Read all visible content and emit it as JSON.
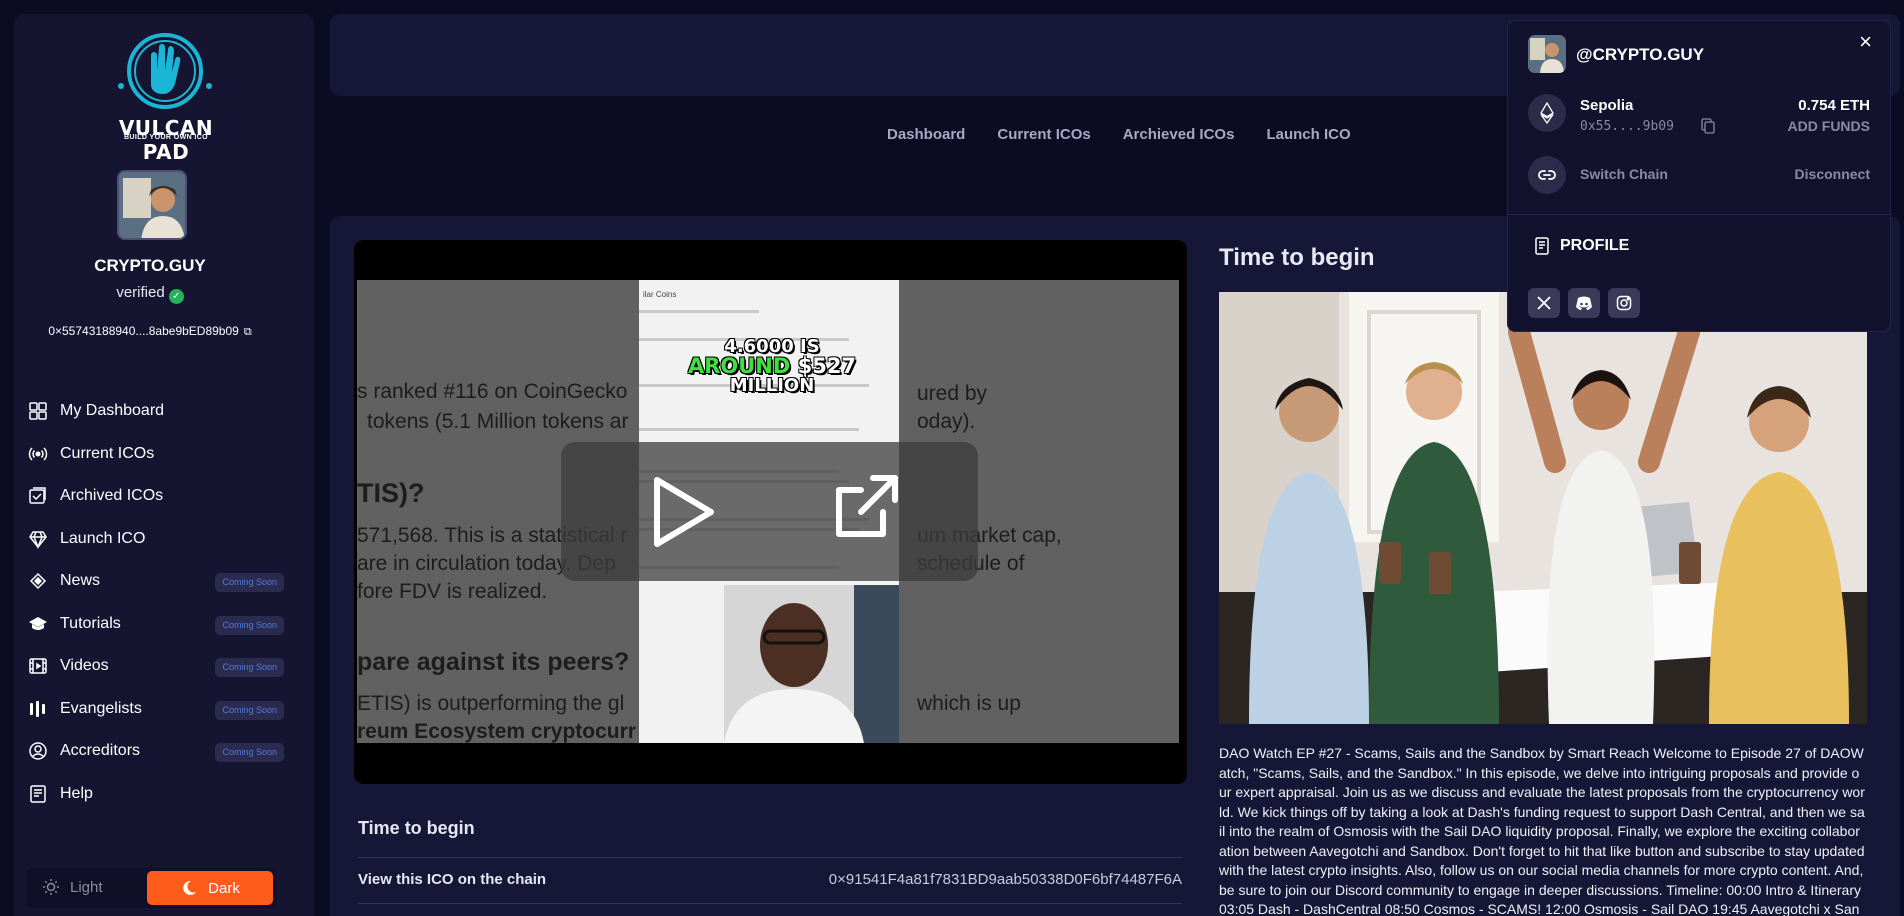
{
  "brand": {
    "name": "VULCAN PAD",
    "tagline": "BUILD YOUR OWN ICO",
    "accent": "#ff5b1a",
    "logo_color": "#1bb5d6"
  },
  "user": {
    "name": "CRYPTO.GUY",
    "verified_label": "verified",
    "address": "0×55743188940....8abe9bED89b09"
  },
  "sidebar": {
    "items": [
      {
        "label": "My Dashboard",
        "icon": "dashboard-icon",
        "badge": ""
      },
      {
        "label": "Current ICOs",
        "icon": "broadcast-icon",
        "badge": ""
      },
      {
        "label": "Archived ICOs",
        "icon": "archive-icon",
        "badge": ""
      },
      {
        "label": "Launch ICO",
        "icon": "diamond-icon",
        "badge": ""
      },
      {
        "label": "News",
        "icon": "news-icon",
        "badge": "Coming Soon"
      },
      {
        "label": "Tutorials",
        "icon": "graduation-cap-icon",
        "badge": "Coming Soon"
      },
      {
        "label": "Videos",
        "icon": "film-icon",
        "badge": "Coming Soon"
      },
      {
        "label": "Evangelists",
        "icon": "bars-icon",
        "badge": "Coming Soon"
      },
      {
        "label": "Accreditors",
        "icon": "user-circle-icon",
        "badge": "Coming Soon"
      },
      {
        "label": "Help",
        "icon": "help-doc-icon",
        "badge": ""
      }
    ]
  },
  "theme": {
    "light": "Light",
    "dark": "Dark"
  },
  "topnav": [
    "Dashboard",
    "Current ICOs",
    "Archieved ICOs",
    "Launch ICO"
  ],
  "video": {
    "bg_heading_1": "s ranked #116 on CoinGecko",
    "bg_heading_2": "tokens (5.1 Million tokens ar",
    "bg_heading_3": "TIS)?",
    "bg_heading_4": "571,568. This is a statistical r",
    "bg_heading_5": "are in circulation today. Dep",
    "bg_heading_6": "fore FDV is realized.",
    "bg_heading_7": "pare against its peers?",
    "bg_heading_8": "ETIS) is outperforming the gl",
    "bg_heading_9": "reum Ecosystem cryptocurr",
    "bg_right_1": "ured by",
    "bg_right_2": "oday).",
    "bg_right_3": "um market cap,",
    "bg_right_4": "schedule of",
    "bg_right_5": "which is up",
    "thumb_header": "ilar Coins",
    "thumb_line1": "4.6000 IS",
    "thumb_line2a": "AROUND",
    "thumb_line2b": "$527",
    "thumb_line3": "MILLION"
  },
  "ico": {
    "title": "Time to begin",
    "chain_label": "View this ICO on the chain",
    "chain_address": "0×91541F4a81f7831BD9aab50338D0F6bf74487F6A"
  },
  "right": {
    "title": "Time to begin",
    "description": "DAO Watch EP #27 - Scams, Sails and the Sandbox by Smart Reach Welcome to Episode 27 of DAOWatch, \"Scams, Sails, and the Sandbox.\" In this episode, we delve into intriguing proposals and provide our expert appraisal. Join us as we discuss and evaluate the latest proposals from the cryptocurrency world. We kick things off by taking a look at Dash's funding request to support Dash Central, and then we sail into the realm of Osmosis with the Sail DAO liquidity proposal. Finally, we explore the exciting collaboration between Aavegotchi and Sandbox. Don't forget to hit that like button and subscribe to stay updated with the latest crypto insights. Also, follow us on our social media channels for more crypto content. And, be sure to join our Discord community to engage in deeper discussions. Timeline: 00:00 Intro & Itinerary 03:05 Dash - DashCentral 08:50 Cosmos - SCAMS! 12:00 Osmosis - Sail DAO 19:45 Aavegotchi x Sandb"
  },
  "wallet": {
    "handle": "@CRYPTO.GUY",
    "network": "Sepolia",
    "address": "0x55....9b09",
    "balance": "0.754 ETH",
    "add_funds": "ADD FUNDS",
    "switch_chain": "Switch Chain",
    "disconnect": "Disconnect",
    "profile": "PROFILE",
    "close": "×",
    "socials": [
      "x-icon",
      "discord-icon",
      "instagram-icon"
    ]
  }
}
